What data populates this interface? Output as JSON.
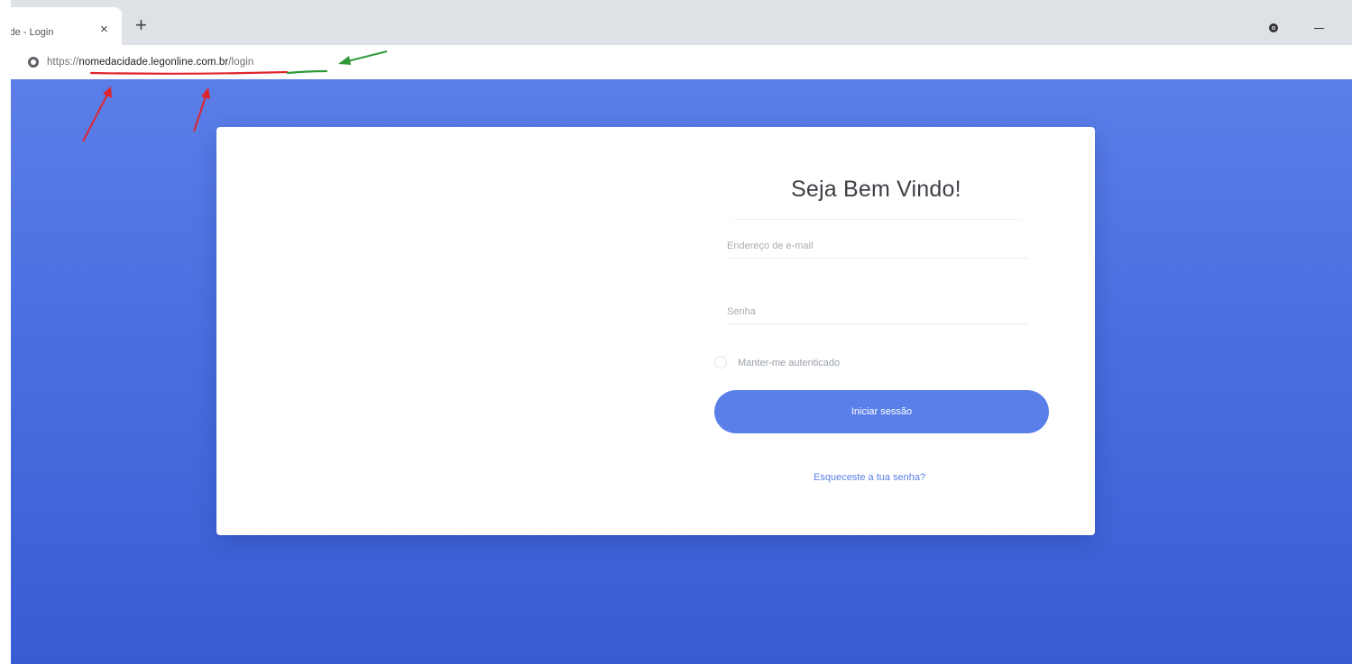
{
  "browser": {
    "tab": {
      "title": "lade - Login",
      "close_glyph": "×",
      "new_tab_glyph": "+"
    },
    "toolbar_icons": [
      "profile-icon",
      "minimize-icon"
    ],
    "address": {
      "scheme": "https://",
      "host": "nomedacidade.legonline.com.br",
      "path": "/login",
      "site_icon": "globe-icon"
    }
  },
  "annotations": {
    "red_underline_color": "#e0242e",
    "green_underline_color": "#2e9a3a",
    "red_arrow_count": 2,
    "green_arrow_count": 1
  },
  "login": {
    "title": "Seja Bem Vindo!",
    "email_placeholder": "Endereço de e-mail",
    "password_placeholder": "Senha",
    "remember_label": "Manter-me autenticado",
    "submit_label": "Iniciar sessão",
    "forgot_label": "Esqueceste a tua senha?"
  },
  "colors": {
    "background_top": "#5b7ee8",
    "background_bottom": "#3a5cd3",
    "button": "#5a7fe8",
    "link": "#5a7fe8"
  }
}
